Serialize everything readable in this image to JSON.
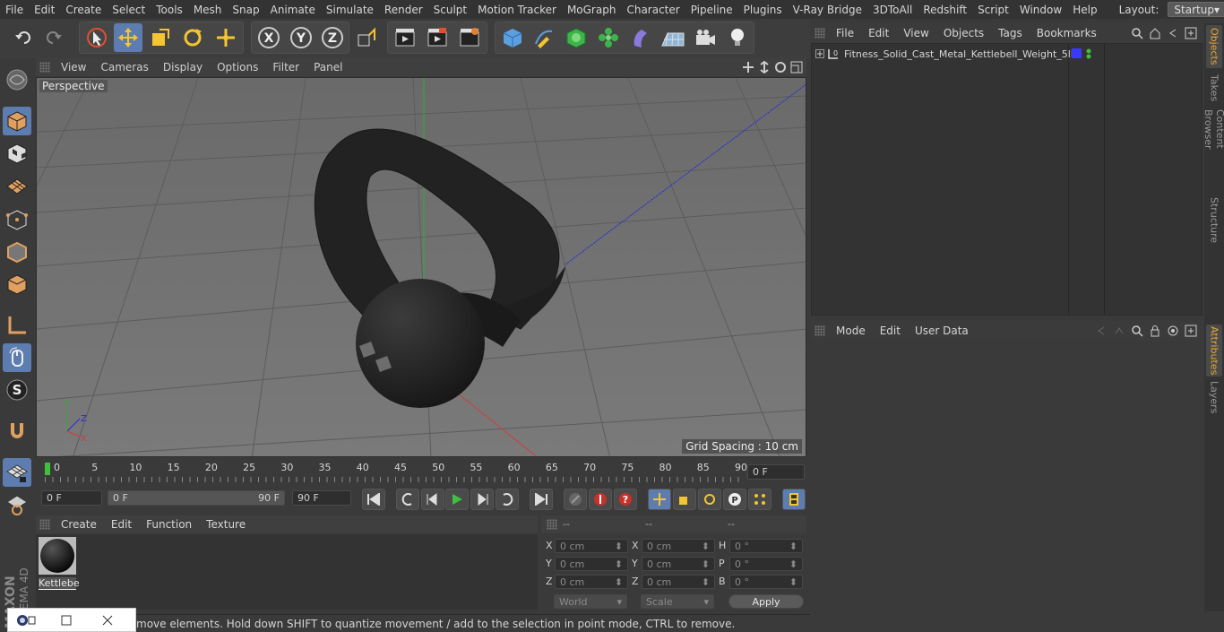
{
  "menubar": {
    "items": [
      "File",
      "Edit",
      "Create",
      "Select",
      "Tools",
      "Mesh",
      "Snap",
      "Animate",
      "Simulate",
      "Render",
      "Sculpt",
      "Motion Tracker",
      "MoGraph",
      "Character",
      "Pipeline",
      "Plugins",
      "V-Ray Bridge",
      "3DToAll",
      "Redshift",
      "Script",
      "Window",
      "Help"
    ],
    "layout_label": "Layout:",
    "layout_value": "Startup"
  },
  "viewport": {
    "menu": [
      "View",
      "Cameras",
      "Display",
      "Options",
      "Filter",
      "Panel"
    ],
    "camera_label": "Perspective",
    "grid_spacing": "Grid Spacing : 10 cm"
  },
  "timeline": {
    "ticks": [
      "0",
      "5",
      "10",
      "15",
      "20",
      "25",
      "30",
      "35",
      "40",
      "45",
      "50",
      "55",
      "60",
      "65",
      "70",
      "75",
      "80",
      "85",
      "90"
    ],
    "current_frame": "0 F",
    "start_field": "0 F",
    "range_start": "0 F",
    "range_end": "90 F",
    "end_field": "90 F"
  },
  "material_manager": {
    "menu": [
      "Create",
      "Edit",
      "Function",
      "Texture"
    ],
    "materials": [
      {
        "name": "Kettlebe"
      }
    ]
  },
  "coordinates": {
    "headers": [
      "--",
      "--",
      "--"
    ],
    "rows": [
      {
        "l1": "X",
        "v1": "0 cm",
        "l2": "X",
        "v2": "0 cm",
        "l3": "H",
        "v3": "0 °"
      },
      {
        "l1": "Y",
        "v1": "0 cm",
        "l2": "Y",
        "v2": "0 cm",
        "l3": "P",
        "v3": "0 °"
      },
      {
        "l1": "Z",
        "v1": "0 cm",
        "l2": "Z",
        "v2": "0 cm",
        "l3": "B",
        "v3": "0 °"
      }
    ],
    "space_select": "World",
    "mode_select": "Scale",
    "apply_label": "Apply"
  },
  "status": {
    "text": "move elements. Hold down SHIFT to quantize movement / add to the selection in point mode, CTRL to remove."
  },
  "object_manager": {
    "menu": [
      "File",
      "Edit",
      "View",
      "Objects",
      "Tags",
      "Bookmarks"
    ],
    "objects": [
      {
        "name": "Fitness_Solid_Cast_Metal_Kettlebell_Weight_5lb",
        "layer_color": "#3a3aff"
      }
    ]
  },
  "attribute_manager": {
    "menu": [
      "Mode",
      "Edit",
      "User Data"
    ]
  },
  "side_tabs": [
    "Objects",
    "Takes",
    "Content Browser",
    "Structure"
  ],
  "side_tabs_lower": [
    "Attributes",
    "Layers"
  ],
  "brand": {
    "maxon": "MAXON",
    "cinema": "CINEMA 4D"
  },
  "colors": {
    "accent": "#5d7db0",
    "active_tab": "#e8a93a",
    "axis_x": "#d23c3c",
    "axis_y": "#3cb43c",
    "axis_z": "#3c3cd2"
  }
}
